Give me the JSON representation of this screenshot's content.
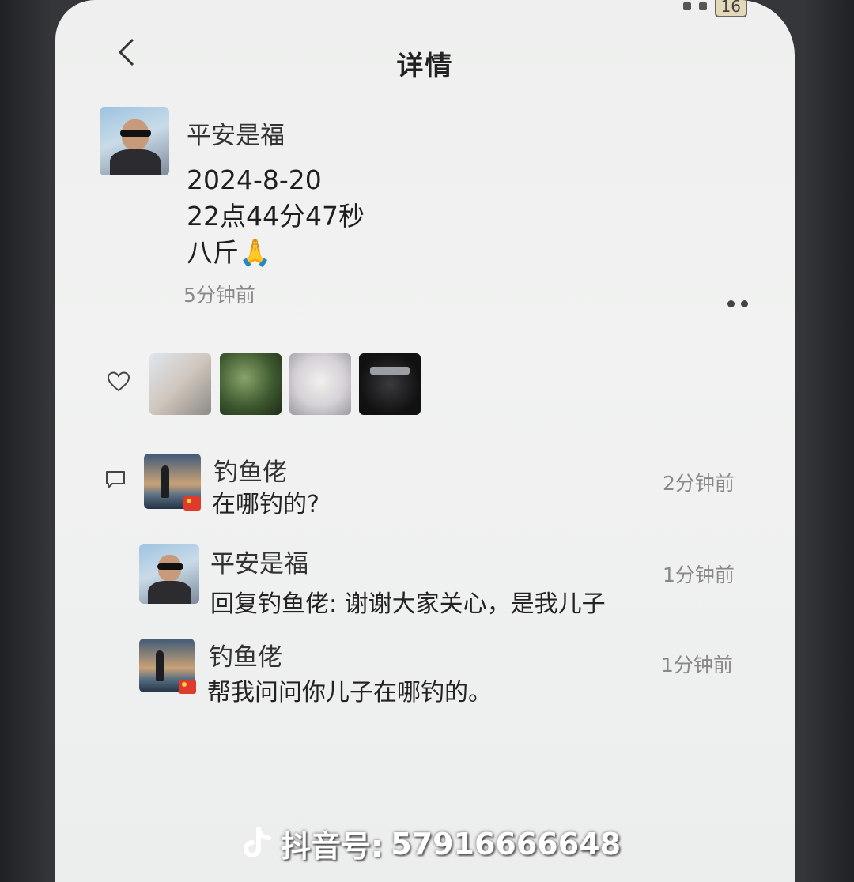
{
  "status": {
    "battery": "16"
  },
  "header": {
    "title": "详情"
  },
  "post": {
    "author": "平安是福",
    "lines": [
      "2024-8-20",
      "22点44分47秒",
      "八斤🙏"
    ],
    "time_ago": "5分钟前"
  },
  "likes": {
    "count_shown": 4
  },
  "comments": [
    {
      "name": "钓鱼佬",
      "text": "在哪钓的?",
      "time": "2分钟前"
    },
    {
      "name": "平安是福",
      "text": "回复钓鱼佬: 谢谢大家关心，是我儿子",
      "time": "1分钟前"
    },
    {
      "name": "钓鱼佬",
      "text": "帮我问问你儿子在哪钓的。",
      "time": "1分钟前"
    }
  ],
  "watermark": {
    "label": "抖音号:",
    "id": "57916666648"
  },
  "colors": {
    "screen_bg": "#eeefee",
    "text": "#222222",
    "muted": "#888888",
    "watermark": "#ffffff"
  }
}
